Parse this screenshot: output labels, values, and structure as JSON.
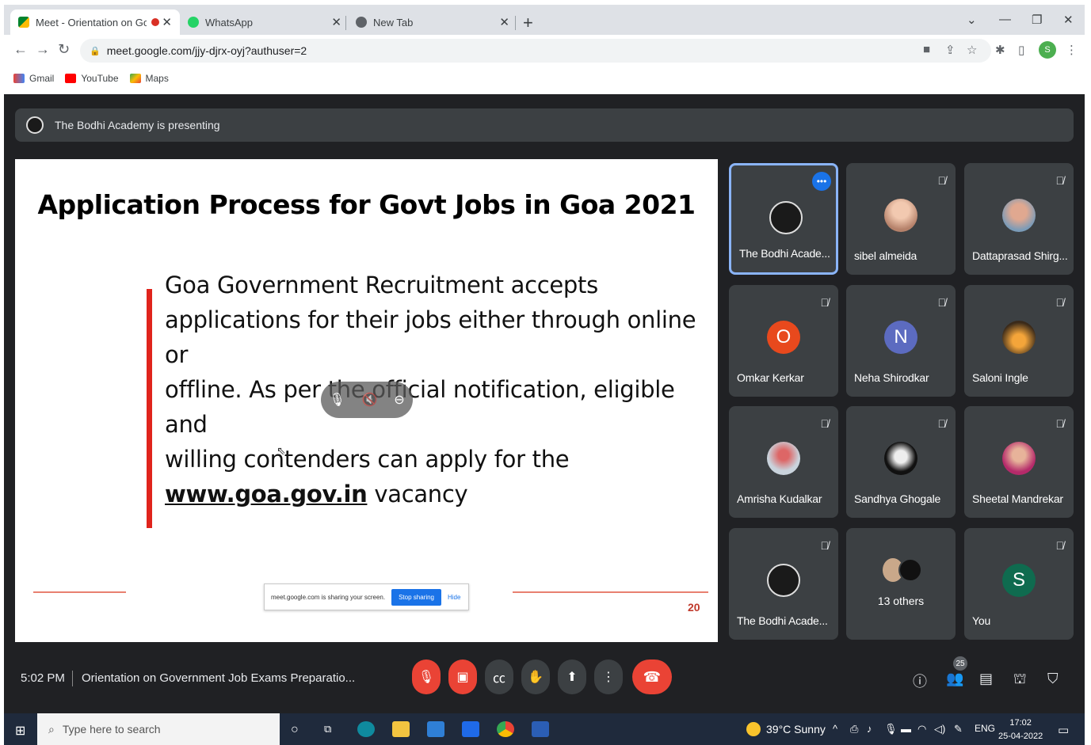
{
  "browser": {
    "tabs": [
      {
        "title": "Meet - Orientation on Gover",
        "recording": true
      },
      {
        "title": "WhatsApp"
      },
      {
        "title": "New Tab"
      }
    ],
    "url": "meet.google.com/jjy-djrx-oyj?authuser=2",
    "profile_initial": "S",
    "bookmarks": [
      "Gmail",
      "YouTube",
      "Maps"
    ]
  },
  "meet": {
    "presenting_text": "The Bodhi Academy is presenting",
    "slide": {
      "title": "Application Process for Govt Jobs in Goa 2021",
      "body_line1": "Goa Government Recruitment accepts",
      "body_line2": "applications for their jobs either through online or",
      "body_line3": "offline. As per the official notification, eligible and",
      "body_line4": "willing contenders can apply for the",
      "link": "www.goa.gov.in",
      "body_end": " vacancy",
      "page_number": "20"
    },
    "share_bar": {
      "text": "meet.google.com is sharing your screen.",
      "stop": "Stop sharing",
      "hide": "Hide"
    },
    "participants": [
      {
        "name": "The Bodhi Acade...",
        "avatar": "logo",
        "active": true
      },
      {
        "name": "sibel almeida",
        "avatar": "photo",
        "muted": true
      },
      {
        "name": "Dattaprasad Shirg...",
        "avatar": "photo",
        "muted": true
      },
      {
        "name": "Omkar Kerkar",
        "avatar": "O",
        "color": "#e8491d",
        "muted": true
      },
      {
        "name": "Neha Shirodkar",
        "avatar": "N",
        "color": "#5c6bc0",
        "muted": true
      },
      {
        "name": "Saloni Ingle",
        "avatar": "photo",
        "muted": true
      },
      {
        "name": "Amrisha Kudalkar",
        "avatar": "photo",
        "muted": true
      },
      {
        "name": "Sandhya Ghogale",
        "avatar": "photo",
        "muted": true
      },
      {
        "name": "Sheetal Mandrekar",
        "avatar": "photo",
        "muted": true
      },
      {
        "name": "The Bodhi Acade...",
        "avatar": "logo",
        "muted": true
      },
      {
        "name": "13 others",
        "avatar": "group"
      },
      {
        "name": "You",
        "avatar": "S",
        "color": "#0f6b4f",
        "muted": true
      }
    ],
    "time": "5:02 PM",
    "meeting_title": "Orientation on Government Job Exams Preparatio...",
    "people_count": "25"
  },
  "taskbar": {
    "search_placeholder": "Type here to search",
    "weather": "39°C  Sunny",
    "lang": "ENG",
    "clock_time": "17:02",
    "clock_date": "25-04-2022"
  }
}
